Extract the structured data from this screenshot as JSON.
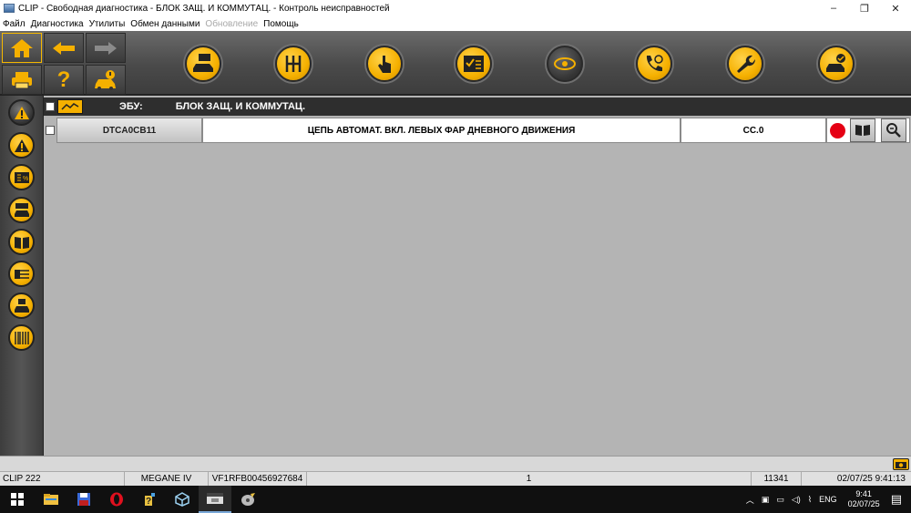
{
  "window": {
    "title": "CLIP - Свободная диагностика - БЛОК ЗАЩ. И КОММУТАЦ. - Контроль неисправностей",
    "minimize": "–",
    "maximize": "❐",
    "close": "✕"
  },
  "menu": [
    {
      "label": "Файл",
      "enabled": true
    },
    {
      "label": "Диагностика",
      "enabled": true
    },
    {
      "label": "Утилиты",
      "enabled": true
    },
    {
      "label": "Обмен данными",
      "enabled": true
    },
    {
      "label": "Обновление",
      "enabled": false
    },
    {
      "label": "Помощь",
      "enabled": true
    }
  ],
  "toolbar": {
    "nav": [
      "home-icon",
      "back-arrow-icon",
      "forward-arrow-icon",
      "printer-icon",
      "help-icon",
      "vehicle-info-icon"
    ],
    "help_label": "?",
    "tools": [
      {
        "icon": "vehicle-identification-icon"
      },
      {
        "icon": "gearbox-icon"
      },
      {
        "icon": "touch-icon"
      },
      {
        "icon": "checklist-icon"
      },
      {
        "icon": "diagnostic-eye-icon",
        "active": true
      },
      {
        "icon": "phone-support-icon"
      },
      {
        "icon": "wrench-icon"
      },
      {
        "icon": "vehicle-check-icon"
      }
    ]
  },
  "sidebar": [
    {
      "icon": "warning-icon",
      "active": true
    },
    {
      "icon": "warning-icon"
    },
    {
      "icon": "percent-list-icon"
    },
    {
      "icon": "vehicle-list-icon"
    },
    {
      "icon": "manual-book-icon"
    },
    {
      "icon": "wiring-icon"
    },
    {
      "icon": "vehicle-save-icon"
    },
    {
      "icon": "barcode-icon"
    }
  ],
  "ecu": {
    "label": "ЭБУ:",
    "name": "БЛОК ЗАЩ. И КОММУТАЦ."
  },
  "dtc_rows": [
    {
      "code": "DTCA0CB11",
      "description": "ЦЕПЬ АВТОМАТ. ВКЛ. ЛЕВЫХ ФАР ДНЕВНОГО ДВИЖЕНИЯ",
      "status": "CC.0",
      "status_color": "#e50014"
    }
  ],
  "status_bar": {
    "clip": "CLIP 222",
    "vehicle": "MEGANE IV",
    "vin": "VF1RFB00456927684",
    "center": "1",
    "number": "11341",
    "datetime": "02/07/25 9:41:13"
  },
  "taskbar": {
    "apps": [
      "windows-start-icon",
      "file-explorer-icon",
      "save-disk-icon",
      "opera-icon",
      "help-tool-icon",
      "cube-icon",
      "clip-app-icon",
      "disc-tool-icon"
    ],
    "lang": "ENG",
    "time": "9:41",
    "date": "02/07/25"
  },
  "colors": {
    "accent": "#f5b000",
    "toolbar_bg": "#4a4a4a",
    "content_bg": "#b4b4b4",
    "error_red": "#e50014"
  }
}
